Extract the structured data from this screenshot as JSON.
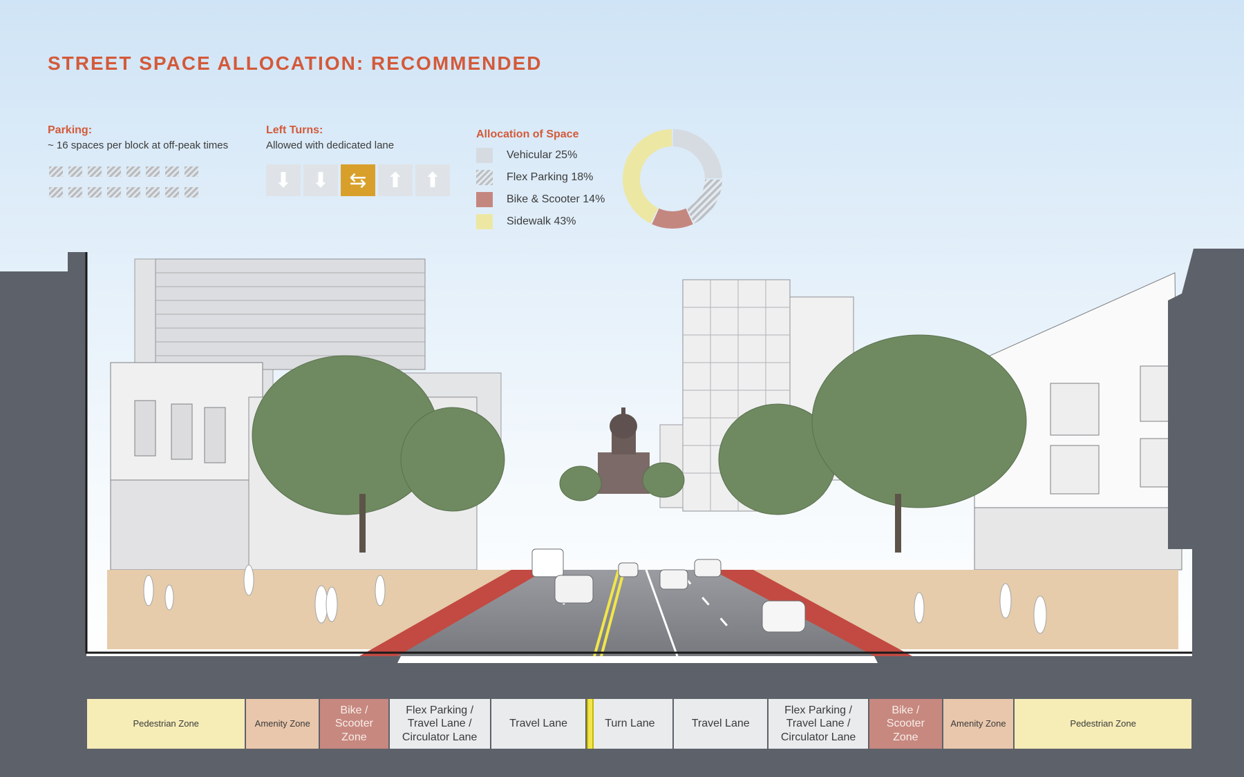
{
  "title": "STREET SPACE ALLOCATION: RECOMMENDED",
  "parking": {
    "label": "Parking:",
    "text": "~ 16 spaces per block at off-peak times",
    "icon_count": 16
  },
  "left_turns": {
    "label": "Left Turns:",
    "text": "Allowed with dedicated lane",
    "arrows": [
      {
        "icon": "down-arrow-icon",
        "active": false
      },
      {
        "icon": "down-arrow-icon",
        "active": false
      },
      {
        "icon": "two-way-turn-arrow-icon",
        "active": true
      },
      {
        "icon": "up-arrow-icon",
        "active": false
      },
      {
        "icon": "up-arrow-icon",
        "active": false
      }
    ]
  },
  "allocation": {
    "label": "Allocation of Space",
    "items": [
      {
        "name": "Vehicular",
        "percent": 25,
        "text": "Vehicular  25%",
        "color": "#d5dbe1",
        "pattern": "solid"
      },
      {
        "name": "Flex Parking",
        "percent": 18,
        "text": "Flex Parking 18%",
        "color": "#b9c0c7",
        "pattern": "hatched"
      },
      {
        "name": "Bike & Scooter",
        "percent": 14,
        "text": "Bike & Scooter  14%",
        "color": "#c4877f",
        "pattern": "solid"
      },
      {
        "name": "Sidewalk",
        "percent": 43,
        "text": "Sidewalk  43%",
        "color": "#ede7a4",
        "pattern": "solid"
      }
    ]
  },
  "zones": [
    {
      "label": "Pedestrian Zone",
      "type": "ped",
      "size": "small",
      "weight": 229
    },
    {
      "label": "Amenity Zone",
      "type": "amen",
      "size": "small",
      "weight": 106
    },
    {
      "label": "Bike /\nScooter\nZone",
      "type": "bike",
      "size": "big",
      "weight": 100
    },
    {
      "label": "Flex Parking /\nTravel Lane /\nCirculator Lane",
      "type": "lane",
      "size": "big",
      "weight": 146
    },
    {
      "label": "Travel Lane",
      "type": "lane",
      "size": "big",
      "weight": 138
    },
    {
      "label": "Turn Lane",
      "type": "lane",
      "size": "big",
      "weight": 125
    },
    {
      "label": "Travel Lane",
      "type": "lane",
      "size": "big",
      "weight": 136
    },
    {
      "label": "Flex Parking /\nTravel Lane /\nCirculator Lane",
      "type": "lane",
      "size": "big",
      "weight": 145
    },
    {
      "label": "Bike /\nScooter\nZone",
      "type": "bike",
      "size": "big",
      "weight": 106
    },
    {
      "label": "Amenity Zone",
      "type": "amen",
      "size": "small",
      "weight": 103
    },
    {
      "label": "Pedestrian Zone",
      "type": "ped",
      "size": "small",
      "weight": 256
    }
  ],
  "colors": {
    "accent": "#d35a3a",
    "section_cut": "#5d6169",
    "bike_lane": "#c9413c",
    "road": "#808287",
    "median_line": "#f2e64a"
  }
}
